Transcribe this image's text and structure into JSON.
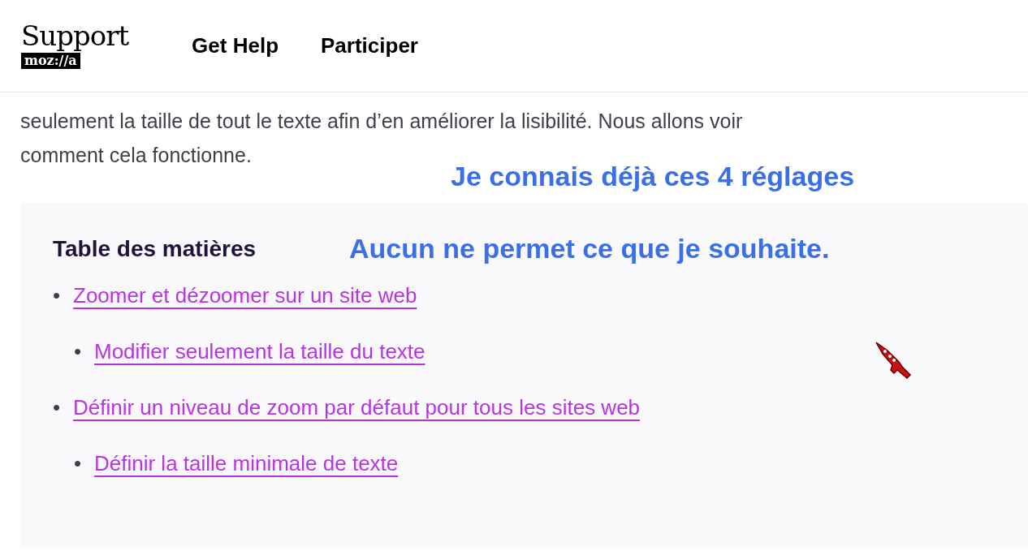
{
  "header": {
    "logo_title": "Support",
    "logo_badge": "moz://a",
    "nav": [
      {
        "label": "Get Help"
      },
      {
        "label": "Participer"
      }
    ]
  },
  "intro": {
    "lines": [
      "seulement la taille de tout le texte afin d’en améliorer la lisibilité. Nous allons voir",
      "comment cela fonctionne."
    ]
  },
  "annotations": [
    "Je connais déjà ces 4 réglages",
    "Aucun ne permet ce que je souhaite."
  ],
  "toc": {
    "title": "Table des matières",
    "items": [
      {
        "marker": "•",
        "label": "Zoomer et dézoomer sur un site web",
        "children": [
          {
            "marker": "•",
            "label": "Modifier seulement la taille du texte"
          }
        ]
      },
      {
        "marker": "•",
        "label": "Définir un niveau de zoom par défaut pour tous les sites web",
        "children": [
          {
            "marker": "•",
            "label": "Définir la taille minimale de texte"
          }
        ]
      }
    ]
  }
}
